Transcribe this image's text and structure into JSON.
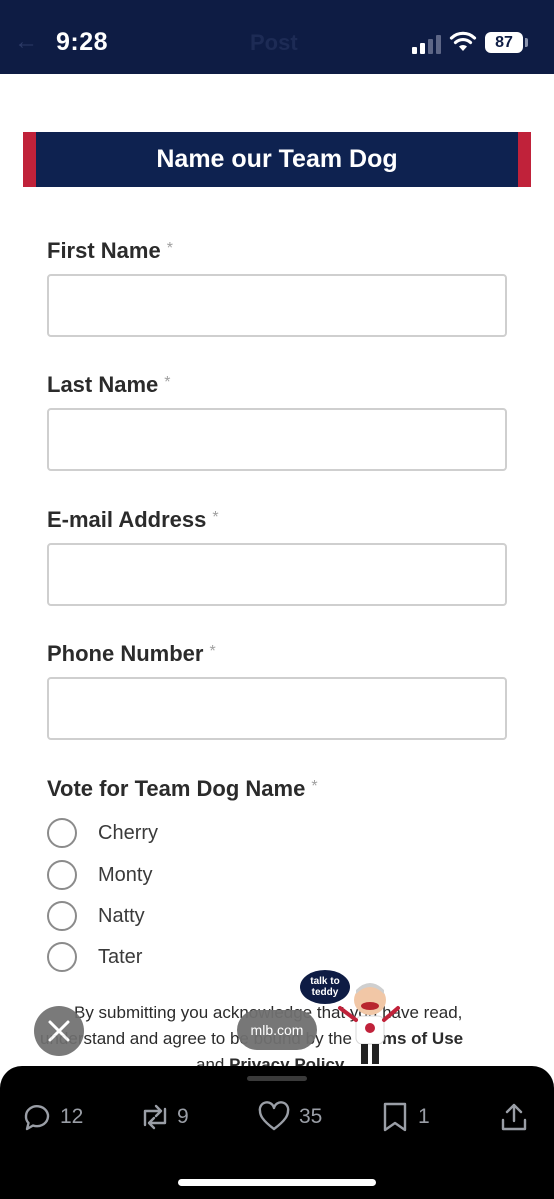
{
  "status_bar": {
    "time": "9:28",
    "back_glyph": "←",
    "ghost_title": "Post",
    "battery": "87"
  },
  "form": {
    "title": "Name our Team Dog",
    "required_mark": "*",
    "fields": {
      "first_name": "First Name",
      "last_name": "Last Name",
      "email": "E-mail Address",
      "phone": "Phone Number"
    },
    "vote": {
      "label": "Vote for Team Dog Name",
      "options": [
        "Cherry",
        "Monty",
        "Natty",
        "Tater"
      ]
    },
    "consent": {
      "line1": "By submitting you acknowledge that you have read,",
      "line2_pre": "understand and agree to be bound by the ",
      "terms": "Terms of Use",
      "line3_pre": "and ",
      "privacy": "Privacy Policy"
    }
  },
  "overlay": {
    "url": "mlb.com",
    "mascot_bubble": "talk to teddy"
  },
  "post_actions": {
    "replies": "12",
    "reposts": "9",
    "likes": "35",
    "bookmarks": "1"
  },
  "colors": {
    "navy": "#0e1c44",
    "banner_navy": "#0e2250",
    "accent_red": "#c0223a",
    "action_gray": "#9a9ea6"
  },
  "icons": [
    "back-arrow-icon",
    "signal-icon",
    "wifi-icon",
    "battery-icon",
    "close-icon",
    "reply-icon",
    "repost-icon",
    "like-icon",
    "bookmark-icon",
    "share-icon"
  ]
}
